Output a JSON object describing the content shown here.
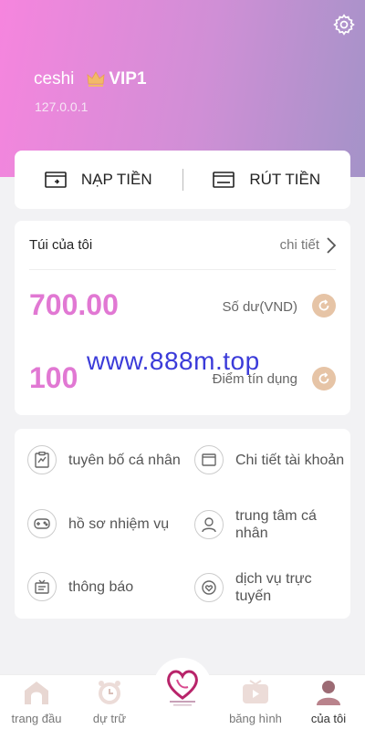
{
  "header": {
    "username": "ceshi",
    "vip": "VIP1",
    "ip": "127.0.0.1"
  },
  "actions": {
    "deposit": "NẠP TIỀN",
    "withdraw": "RÚT TIỀN"
  },
  "wallet": {
    "title": "Túi của tôi",
    "detail": "chi tiết",
    "balance": "700.00",
    "balance_label": "Số dư(VND)",
    "credit": "100",
    "credit_label": "Điểm tín dụng"
  },
  "watermark": "www.888m.top",
  "menu": {
    "statement": "tuyên bố cá nhân",
    "account_detail": "Chi tiết tài khoản",
    "task_record": "hồ sơ nhiệm vụ",
    "personal_center": "trung tâm cá nhân",
    "notice": "thông báo",
    "online_service": "dịch vụ trực tuyến"
  },
  "tabs": {
    "home": "trang đầu",
    "reserve": "dự trữ",
    "screen": "băng hình",
    "mine": "của tôi"
  },
  "colors": {
    "accent_pink": "#e178d3",
    "refresh_bg": "#e6c4a6"
  }
}
